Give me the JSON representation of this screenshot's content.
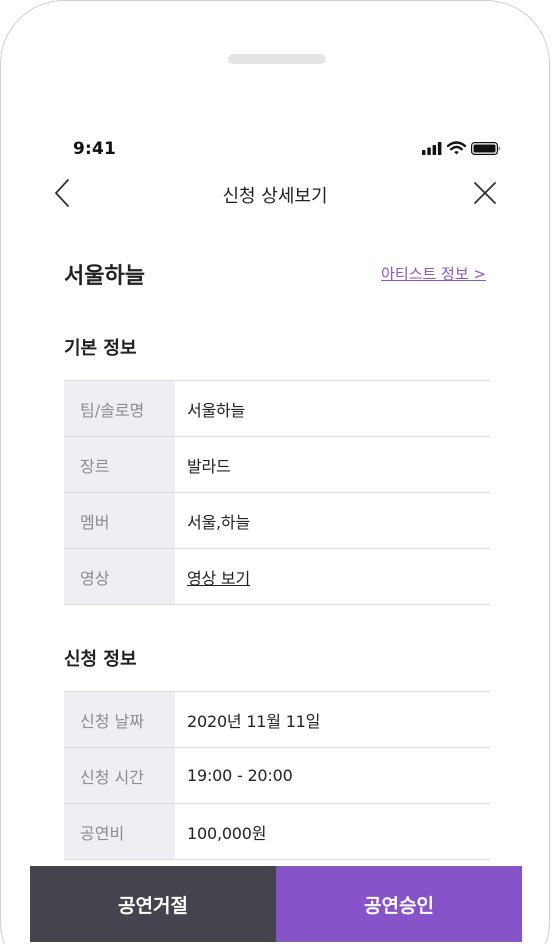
{
  "status_bar": {
    "time": "9:41"
  },
  "header": {
    "title": "신청 상세보기"
  },
  "artist": {
    "name": "서울하늘",
    "info_link": "아티스트 정보 >"
  },
  "basic_info": {
    "title": "기본 정보",
    "rows": [
      {
        "label": "팀/솔로명",
        "value": "서울하늘"
      },
      {
        "label": "장르",
        "value": "발라드"
      },
      {
        "label": "멤버",
        "value": "서울,하늘"
      },
      {
        "label": "영상",
        "value": "영상 보기"
      }
    ]
  },
  "application_info": {
    "title": "신청 정보",
    "rows": [
      {
        "label": "신청 날짜",
        "value": "2020년 11월 11일"
      },
      {
        "label": "신청 시간",
        "value": "19:00 - 20:00"
      },
      {
        "label": "공연비",
        "value": "100,000원"
      }
    ]
  },
  "actions": {
    "reject_label": "공연거절",
    "approve_label": "공연승인"
  },
  "colors": {
    "accent": "#8653c8",
    "reject": "#44444f",
    "label_bg": "#eeeff3"
  },
  "icons": [
    "signal-icon",
    "wifi-icon",
    "battery-icon",
    "back-chevron-icon",
    "close-icon"
  ]
}
